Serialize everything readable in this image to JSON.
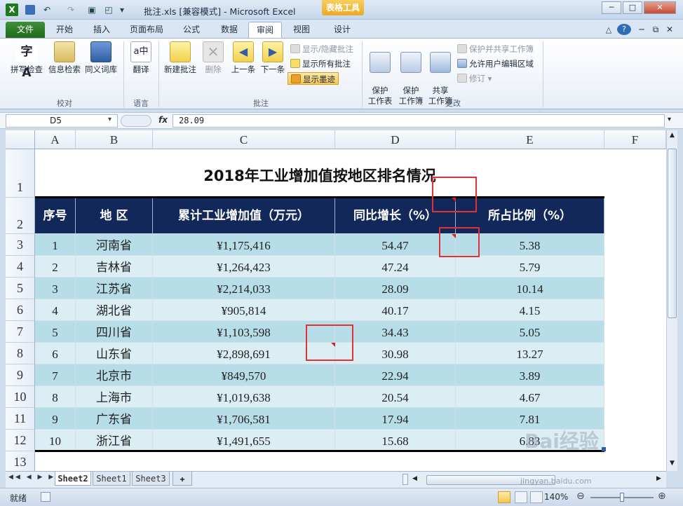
{
  "window": {
    "title": "批注.xls  [兼容模式] - Microsoft Excel",
    "context_tab": "表格工具",
    "controls": [
      "─",
      "□",
      "✕"
    ]
  },
  "quick_access": {
    "app_icon": "X",
    "dropdown": "▾"
  },
  "ribbon_tabs": [
    "文件",
    "开始",
    "插入",
    "页面布局",
    "公式",
    "数据",
    "审阅",
    "视图",
    "设计"
  ],
  "active_tab": "审阅",
  "ribbon": {
    "proofing": {
      "label": "校对",
      "buttons": [
        "拼写检查",
        "信息检索",
        "同义词库"
      ]
    },
    "language": {
      "label": "语言",
      "buttons": [
        "翻译"
      ]
    },
    "comments": {
      "label": "批注",
      "buttons": [
        "新建批注",
        "删除",
        "上一条",
        "下一条"
      ],
      "small_buttons": [
        "显示/隐藏批注",
        "显示所有批注",
        "显示墨迹"
      ]
    },
    "changes": {
      "label": "更改",
      "buttons": [
        "保护\n工作表",
        "保护\n工作簿",
        "共享\n工作簿"
      ],
      "small_buttons": [
        "保护并共享工作簿",
        "允许用户编辑区域",
        "修订"
      ]
    }
  },
  "formula_bar": {
    "name_box": "D5",
    "fx": "fx",
    "value": "28.09"
  },
  "columns": [
    "A",
    "B",
    "C",
    "D",
    "E",
    "F"
  ],
  "rows": [
    "1",
    "2",
    "3",
    "4",
    "5",
    "6",
    "7",
    "8",
    "9",
    "10",
    "11",
    "12",
    "13"
  ],
  "sheet_title": "2018年工业增加值按地区排名情况",
  "table": {
    "headers": [
      "序号",
      "地 区",
      "累计工业增加值（万元）",
      "同比增长（%）",
      "所占比例（%）"
    ],
    "rows": [
      [
        "1",
        "河南省",
        "¥1,175,416",
        "54.47",
        "5.38"
      ],
      [
        "2",
        "吉林省",
        "¥1,264,423",
        "47.24",
        "5.79"
      ],
      [
        "3",
        "江苏省",
        "¥2,214,033",
        "28.09",
        "10.14"
      ],
      [
        "4",
        "湖北省",
        "¥905,814",
        "40.17",
        "4.15"
      ],
      [
        "5",
        "四川省",
        "¥1,103,598",
        "34.43",
        "5.05"
      ],
      [
        "6",
        "山东省",
        "¥2,898,691",
        "30.98",
        "13.27"
      ],
      [
        "7",
        "北京市",
        "¥849,570",
        "22.94",
        "3.89"
      ],
      [
        "8",
        "上海市",
        "¥1,019,638",
        "20.54",
        "4.67"
      ],
      [
        "9",
        "广东省",
        "¥1,706,581",
        "17.94",
        "7.81"
      ],
      [
        "10",
        "浙江省",
        "¥1,491,655",
        "15.68",
        "6.83"
      ]
    ]
  },
  "sheet_tabs": [
    "Sheet2",
    "Sheet1",
    "Sheet3"
  ],
  "active_sheet": "Sheet2",
  "status": {
    "ready": "就绪",
    "zoom": "140%"
  },
  "watermark": {
    "text": "Bai经验",
    "url": "jingyan.baidu.com"
  },
  "colors": {
    "header_bg": "#13285a",
    "band_dark": "#b7dde8",
    "band_light": "#daeef3",
    "highlight": "#e03333",
    "file_tab": "#2a7a25"
  }
}
